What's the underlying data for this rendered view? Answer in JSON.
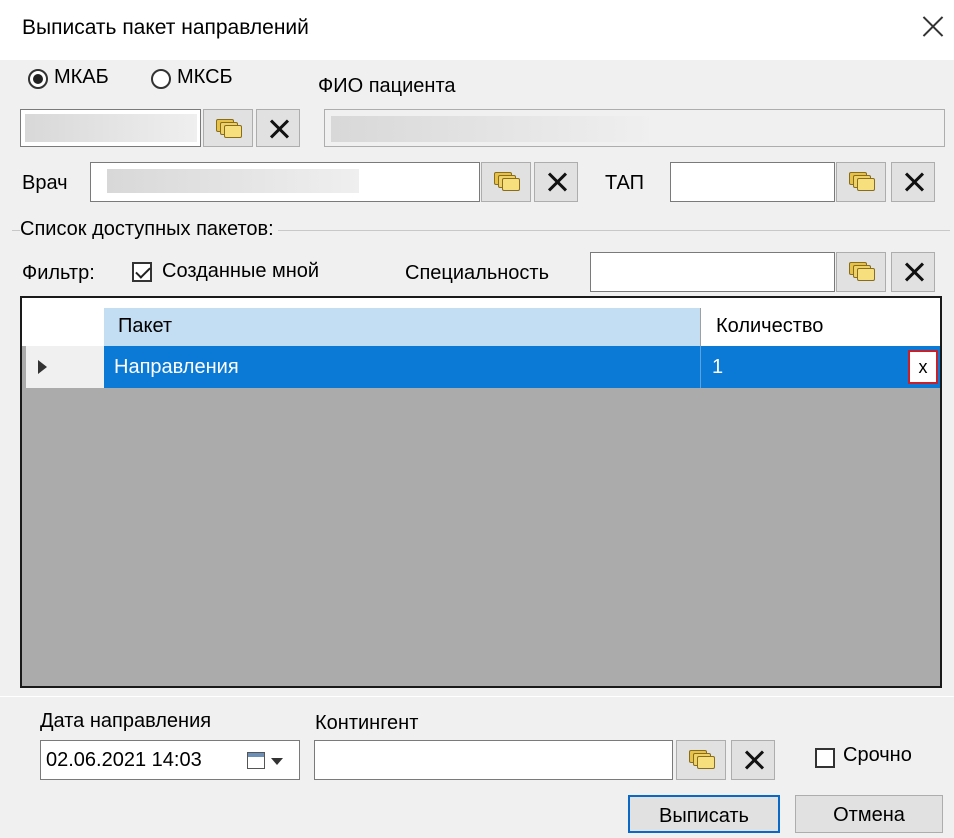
{
  "window": {
    "title": "Выписать пакет направлений",
    "close_icon": "close-icon"
  },
  "patient": {
    "card_type_options": [
      "МКАБ",
      "МКСБ"
    ],
    "selected_card_type": "МКАБ",
    "fio_label": "ФИО пациента",
    "card_value": "",
    "fio_value": ""
  },
  "doctor": {
    "label": "Врач",
    "value": ""
  },
  "tap": {
    "label": "ТАП",
    "value": ""
  },
  "packages": {
    "group_label": "Список доступных пакетов:",
    "filter_label": "Фильтр:",
    "created_by_me_label": "Созданные мной",
    "created_by_me_checked": true,
    "specialty_label": "Специальность",
    "specialty_value": ""
  },
  "table": {
    "columns": [
      "Пакет",
      "Количество"
    ],
    "rows": [
      {
        "package": "Направления",
        "count": "1",
        "delete_label": "x",
        "selected": true
      }
    ]
  },
  "footer": {
    "date_label": "Дата направления",
    "date_value": "02.06.2021 14:03",
    "contingent_label": "Контингент",
    "contingent_value": "",
    "urgent_label": "Срочно",
    "urgent_checked": false,
    "submit_label": "Выписать",
    "cancel_label": "Отмена"
  },
  "colors": {
    "selection": "#0a7ad6",
    "header_highlight": "#c3ddf2",
    "grid_bg": "#ababab",
    "delete_border": "#c8202a"
  }
}
